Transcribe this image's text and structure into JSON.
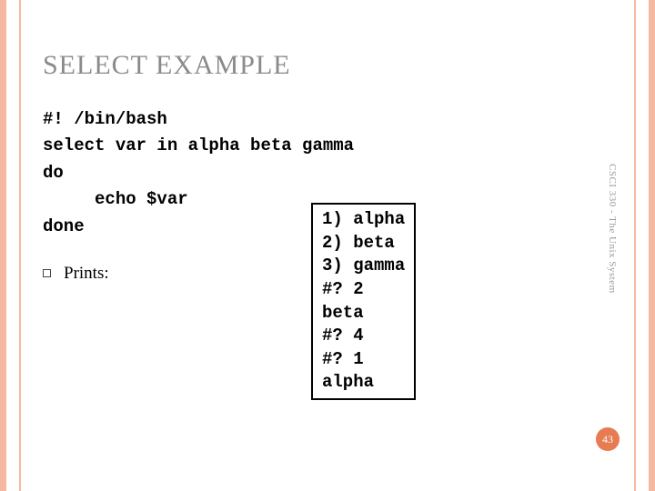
{
  "title": "SELECT EXAMPLE",
  "code": {
    "l1": "#! /bin/bash",
    "l2": "select var in alpha beta gamma",
    "l3": "do",
    "l4": "     echo $var",
    "l5": "done"
  },
  "bullet": "Prints:",
  "output": {
    "l1": "1) alpha",
    "l2": "2) beta",
    "l3": "3) gamma",
    "l4": "#? 2",
    "l5": "beta",
    "l6": "#? 4",
    "l7": "#? 1",
    "l8": "alpha"
  },
  "side_label": "CSCI 330 - The Unix System",
  "page_number": "43",
  "colors": {
    "accent": "#f4b9a0",
    "badge": "#e77b52",
    "title_gray": "#8a8a8a"
  }
}
